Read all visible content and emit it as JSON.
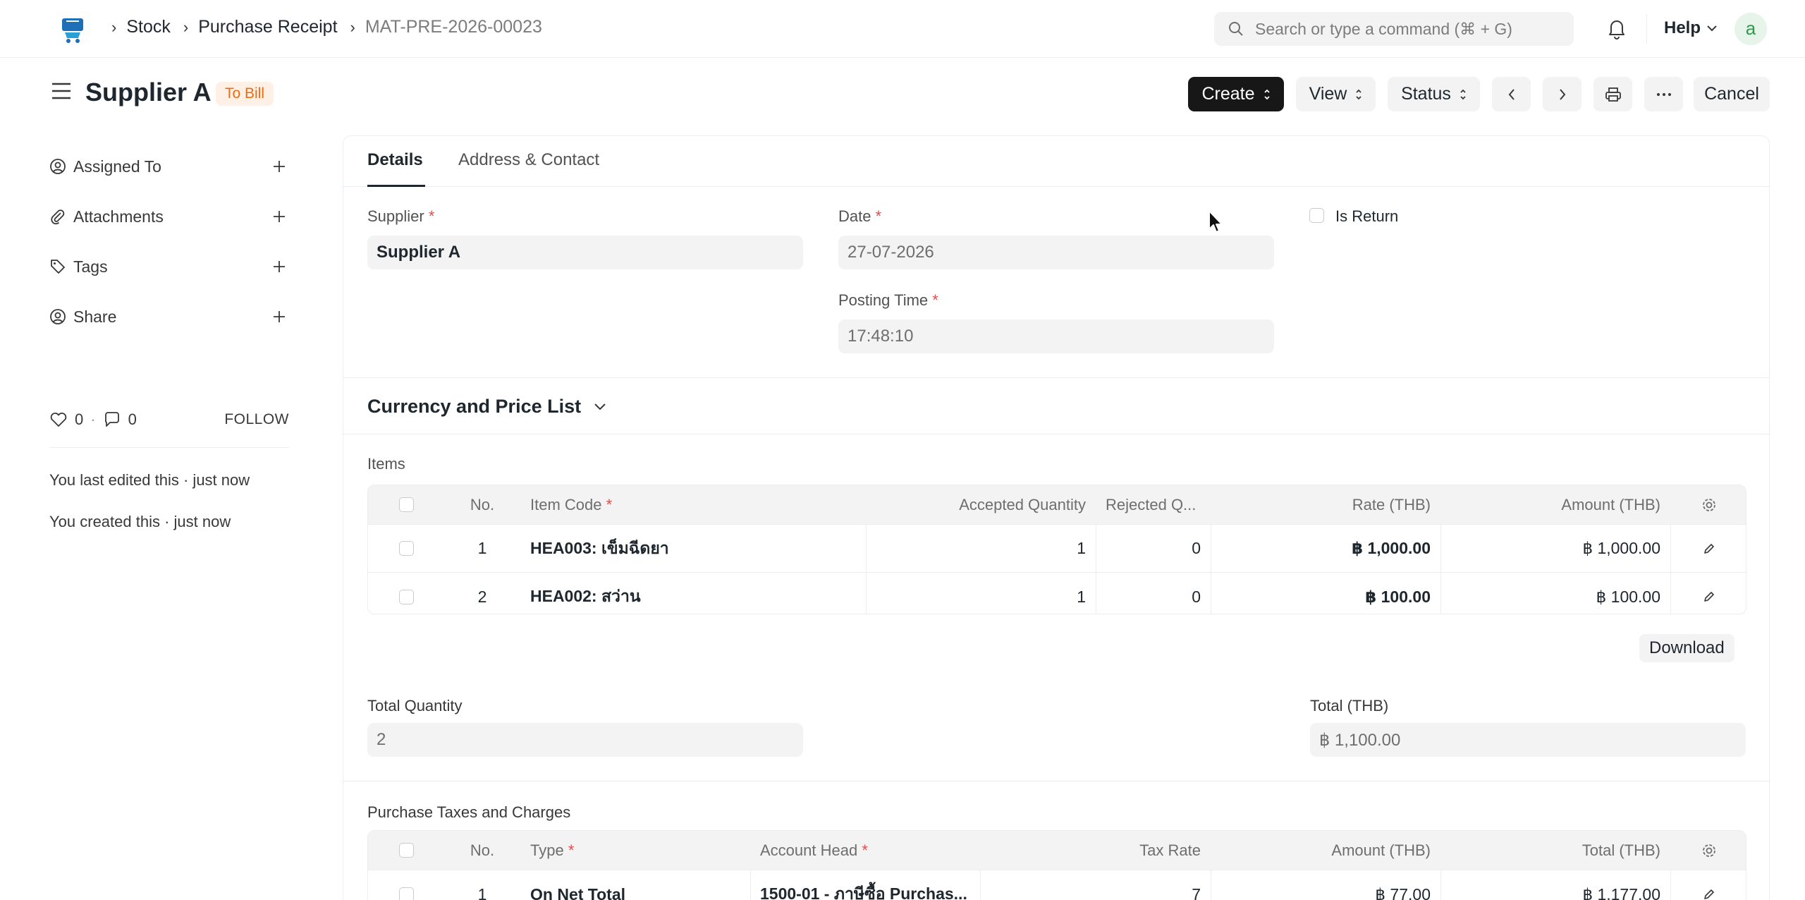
{
  "navbar": {
    "breadcrumbs": [
      "Stock",
      "Purchase Receipt",
      "MAT-PRE-2026-00023"
    ],
    "search_placeholder": "Search or type a command (⌘ + G)",
    "help_label": "Help",
    "avatar_initial": "a"
  },
  "page": {
    "title": "Supplier A",
    "status": "To Bill",
    "buttons": {
      "create": "Create",
      "view": "View",
      "status": "Status",
      "cancel": "Cancel"
    }
  },
  "sidebar": {
    "items": [
      {
        "label": "Assigned To",
        "icon": "assign-icon"
      },
      {
        "label": "Attachments",
        "icon": "paperclip-icon"
      },
      {
        "label": "Tags",
        "icon": "tag-icon"
      },
      {
        "label": "Share",
        "icon": "share-icon"
      }
    ],
    "likes": "0",
    "comments": "0",
    "follow": "FOLLOW",
    "last_edited": "You last edited this · just now",
    "created": "You created this · just now"
  },
  "tabs": [
    "Details",
    "Address & Contact"
  ],
  "form": {
    "supplier_label": "Supplier",
    "supplier_value": "Supplier A",
    "date_label": "Date",
    "date_value": "27-07-2026",
    "posting_time_label": "Posting Time",
    "posting_time_value": "17:48:10",
    "is_return_label": "Is Return",
    "currency_section": "Currency and Price List",
    "items_label": "Items",
    "total_quantity_label": "Total Quantity",
    "total_quantity_value": "2",
    "total_label": "Total (THB)",
    "total_value": "฿ 1,100.00",
    "download": "Download",
    "taxes_label": "Purchase Taxes and Charges"
  },
  "items_table": {
    "headers": [
      "No.",
      "Item Code",
      "Accepted Quantity",
      "Rejected Q...",
      "Rate (THB)",
      "Amount (THB)"
    ],
    "rows": [
      {
        "no": "1",
        "item_code": "HEA003: เข็มฉีดยา",
        "accepted": "1",
        "rejected": "0",
        "rate": "฿ 1,000.00",
        "amount": "฿ 1,000.00"
      },
      {
        "no": "2",
        "item_code": "HEA002: สว่าน",
        "accepted": "1",
        "rejected": "0",
        "rate": "฿ 100.00",
        "amount": "฿ 100.00"
      }
    ]
  },
  "taxes_table": {
    "headers": [
      "No.",
      "Type",
      "Account Head",
      "Tax Rate",
      "Amount (THB)",
      "Total (THB)"
    ],
    "rows": [
      {
        "no": "1",
        "type": "On Net Total",
        "account_head": "1500-01 - ภาษีซื้อ Purchas...",
        "tax_rate": "7",
        "amount": "฿ 77.00",
        "total": "฿ 1,177.00"
      }
    ]
  },
  "colors": {
    "primary_button": "#171717",
    "status_badge_bg": "#fff0e6",
    "status_badge_text": "#e86c13",
    "required": "#e24c4c"
  }
}
